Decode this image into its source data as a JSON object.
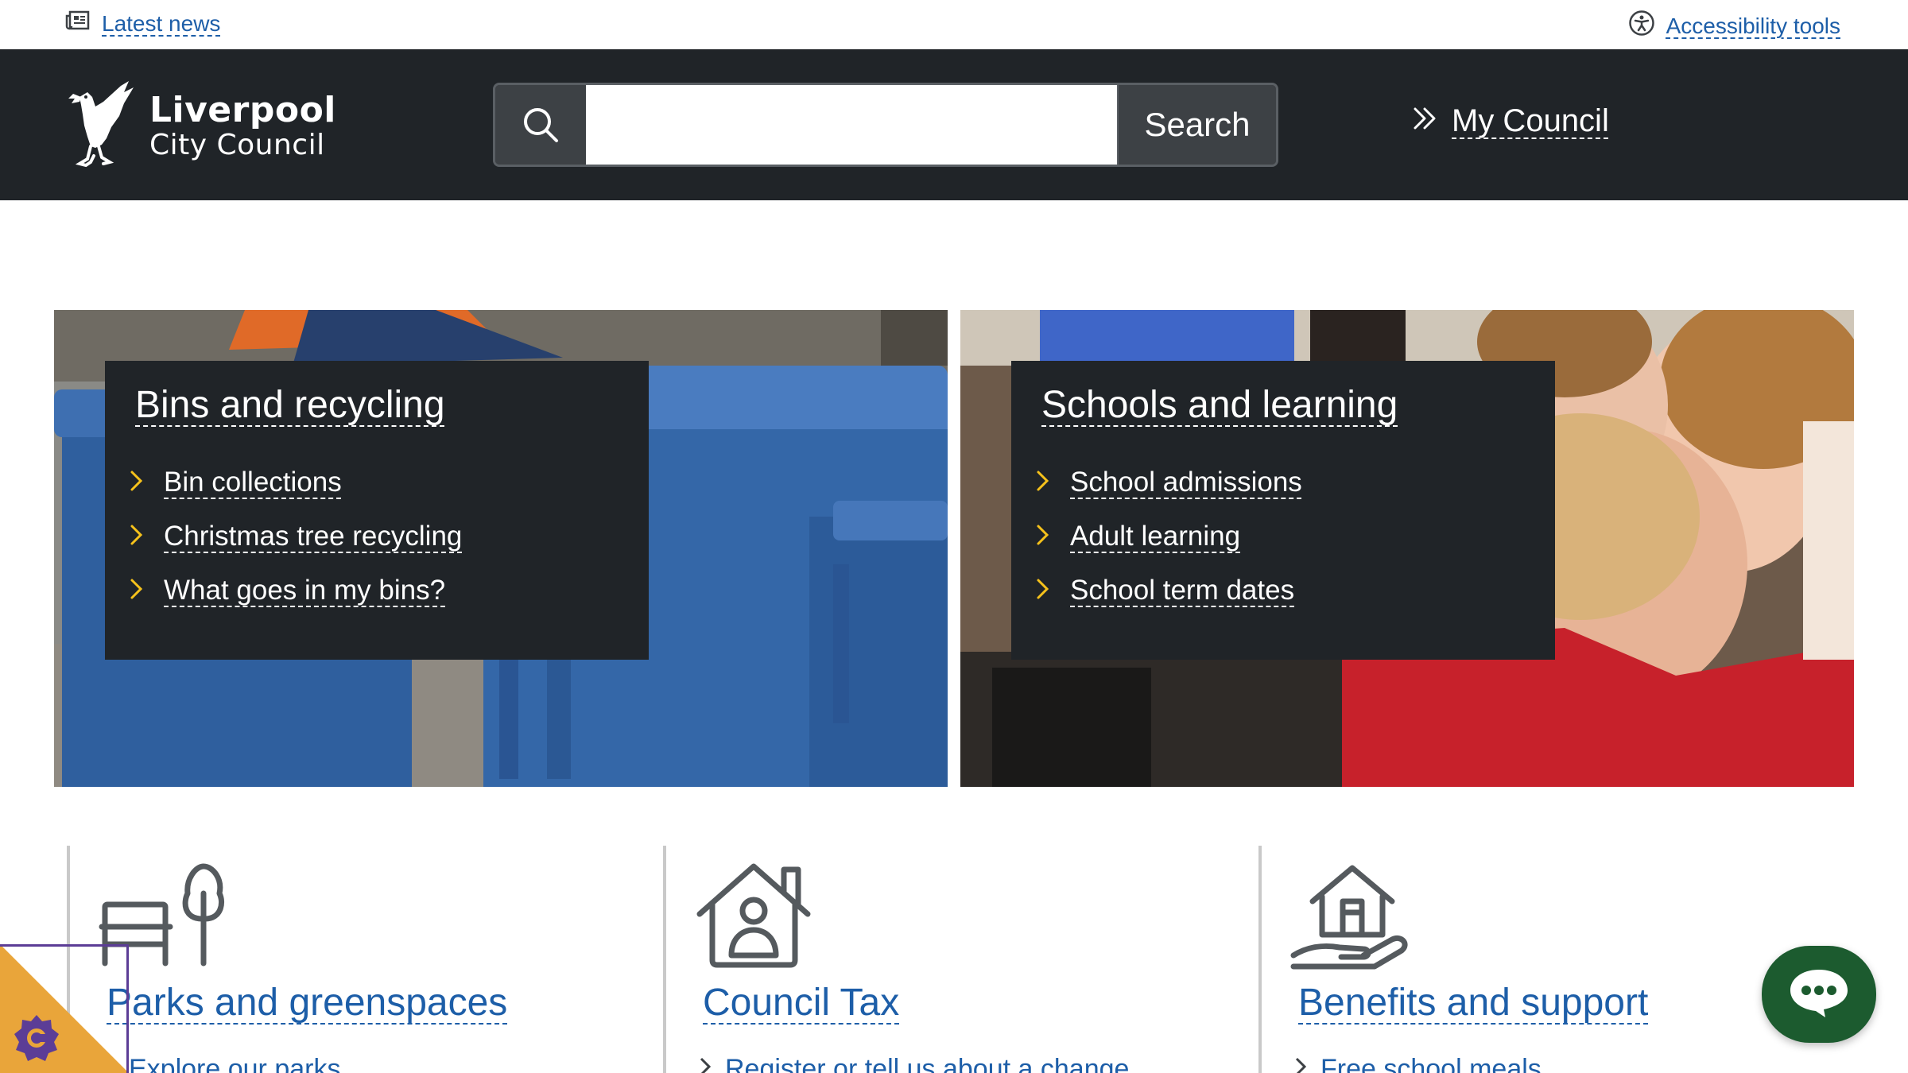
{
  "utility": {
    "news_label": "Latest news",
    "accessibility_label": "Accessibility tools"
  },
  "header": {
    "logo_line1": "Liverpool",
    "logo_line2": "City Council",
    "search_button": "Search",
    "search_value": "",
    "my_council": "My Council"
  },
  "features": [
    {
      "title": "Bins and recycling",
      "links": [
        "Bin collections",
        "Christmas tree recycling",
        "What goes in my bins?"
      ]
    },
    {
      "title": "Schools and learning",
      "links": [
        "School admissions",
        "Adult learning",
        "School term dates"
      ]
    }
  ],
  "services": [
    {
      "title": "Parks and greenspaces",
      "sub": "Explore our parks",
      "icon": "park-bench-tree-icon"
    },
    {
      "title": "Council Tax",
      "sub": "Register or tell us about a change",
      "icon": "house-person-icon"
    },
    {
      "title": "Benefits and support",
      "sub": "Free school meals",
      "icon": "hand-house-icon"
    }
  ],
  "colors": {
    "header_bg": "#202428",
    "link_blue": "#1d5ea8",
    "chevron_yellow": "#f6c21b",
    "chat_green": "#1c5b2f",
    "cookie_orange": "#e9a53a",
    "cookie_purple": "#5c3d96"
  }
}
